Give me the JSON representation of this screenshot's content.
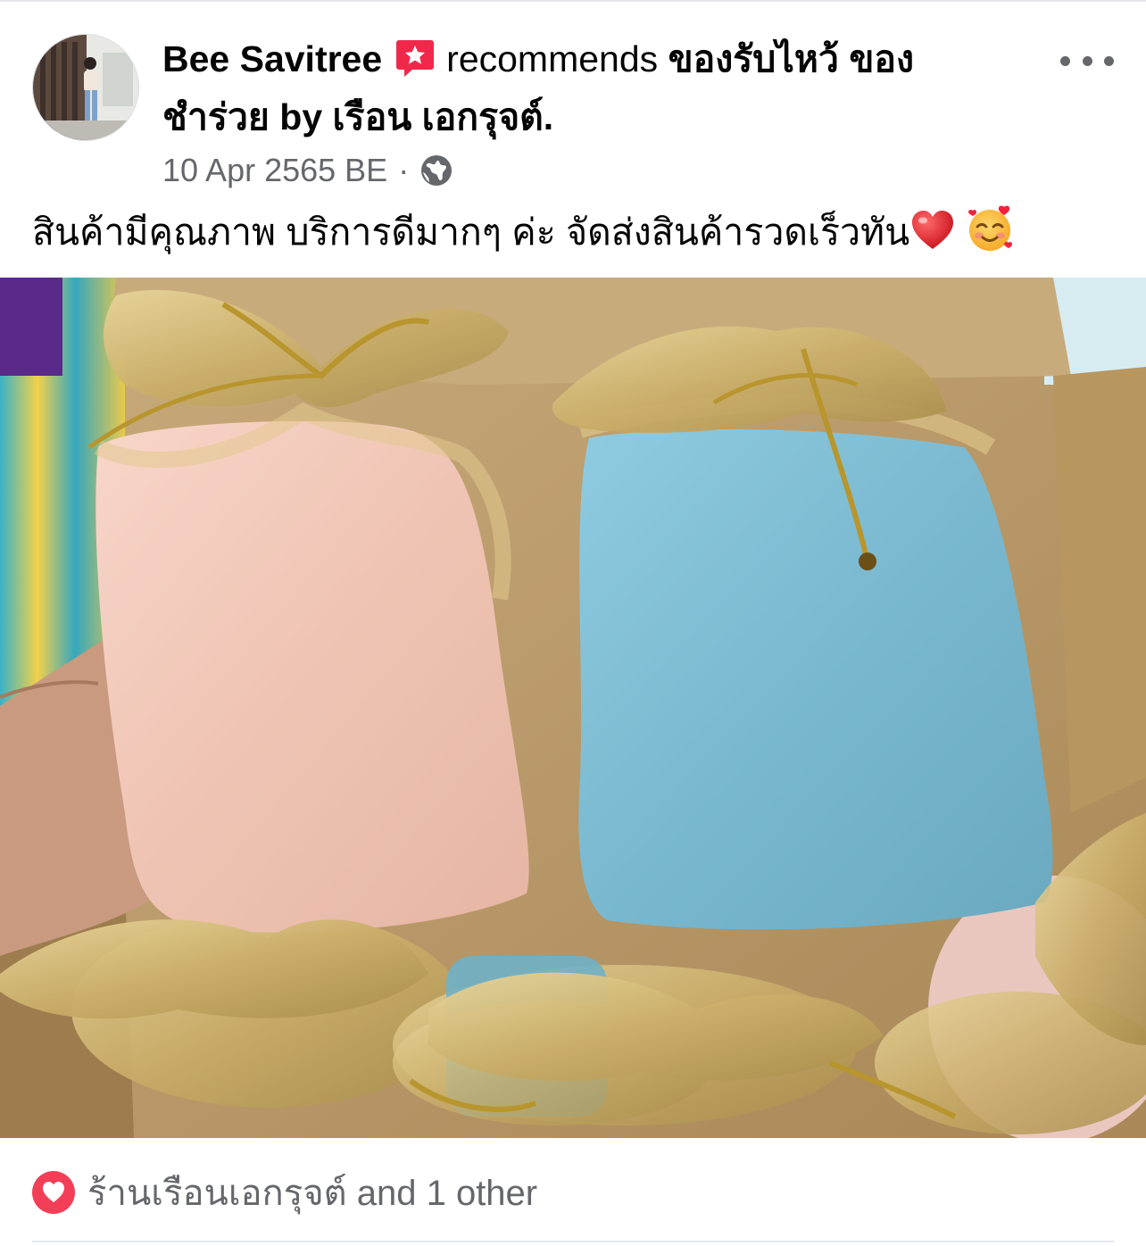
{
  "post": {
    "author": "Bee Savitree",
    "verb": "recommends",
    "page_name_line1": "ของรับไหว้ ของ",
    "page_name_line2": "ชำร่วย by เรือน เอกรุจต์.",
    "date": "10 Apr 2565 BE",
    "separator": "·",
    "privacy_icon": "globe-icon",
    "text": "สินค้ามีคุณภาพ บริการดีมากๆ ค่ะ จัดส่งสินค้ารวดเร็วทัน",
    "emojis": [
      "red-heart",
      "smiling-face-with-hearts"
    ],
    "badge_icon": "recommendation-badge-icon",
    "more_icon": "more-options-icon"
  },
  "reactions": {
    "icon": "love-reaction-icon",
    "summary": "ร้านเรือนเอกรุจต์ and 1 other"
  },
  "colors": {
    "secondary_text": "#65676b",
    "badge": "#f0284a",
    "love_reaction": "#f33e58",
    "divider": "#e4e6eb"
  }
}
